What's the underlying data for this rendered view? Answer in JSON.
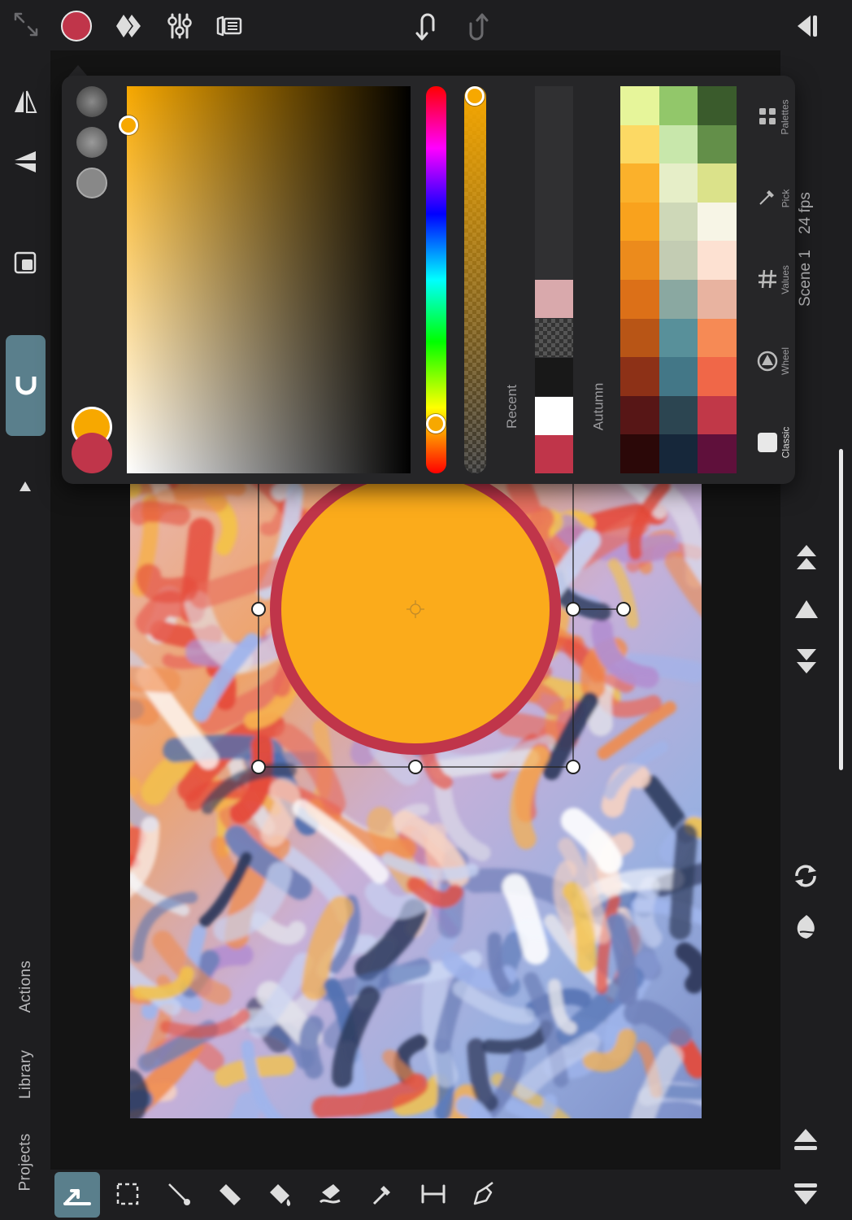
{
  "left_sidebar": {
    "nav": [
      "Actions",
      "Library",
      "Projects"
    ]
  },
  "right_bar": {
    "scene": "Scene 1",
    "fps": "24 fps"
  },
  "color_picker": {
    "current_color": "#f7a800",
    "previous_color": "#c0354a",
    "recent_label": "Recent",
    "palette_label": "Autumn",
    "recent_colors": [
      "#d9a9ac",
      "transparent",
      "#181818",
      "#ffffff",
      "#c0354a"
    ],
    "tabs": [
      "Palettes",
      "Pick",
      "Values",
      "Wheel",
      "Classic"
    ],
    "active_tab": "Classic",
    "palette": [
      [
        "#e6f59a",
        "#92c76a",
        "#3a5b2c"
      ],
      [
        "#fcd964",
        "#c8e7ab",
        "#638f49"
      ],
      [
        "#fbb12b",
        "#e6eec8",
        "#dbe28a"
      ],
      [
        "#f9a21d",
        "#ced8b8",
        "#f7f5e6"
      ],
      [
        "#ec8b1c",
        "#c3ccb3",
        "#fde1d2"
      ],
      [
        "#dc7018",
        "#8aa8a1",
        "#e8b3a0"
      ],
      [
        "#b85516",
        "#58909a",
        "#f68a55"
      ],
      [
        "#8d3117",
        "#437787",
        "#f06748"
      ],
      [
        "#571616",
        "#2c4551",
        "#c13848"
      ],
      [
        "#2b0808",
        "#16273a",
        "#5f103b"
      ]
    ]
  },
  "colors": {
    "accent_teal": "#5a7f8c",
    "selection_fill": "#fbab1b",
    "selection_stroke": "#c0354a"
  }
}
